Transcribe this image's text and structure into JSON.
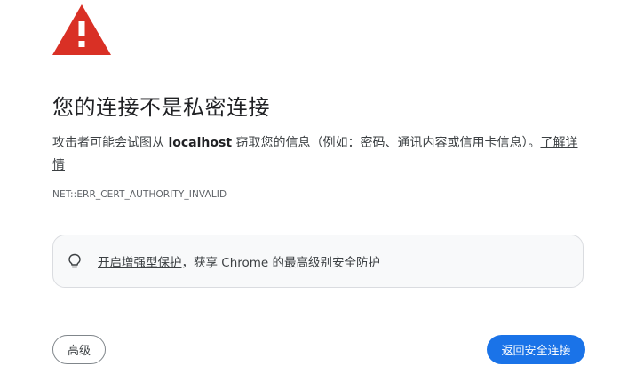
{
  "interstitial": {
    "title": "您的连接不是私密连接",
    "description": {
      "prefix": "攻击者可能会试图从 ",
      "host": "localhost",
      "suffix": " 窃取您的信息（例如：密码、通讯内容或信用卡信息）。",
      "learn_more": "了解详情"
    },
    "error_code": "NET::ERR_CERT_AUTHORITY_INVALID",
    "enhanced_protection": {
      "link_text": "开启增强型保护",
      "rest_text": "，获享 Chrome 的最高级别安全防护",
      "icon": "lightbulb-icon"
    },
    "buttons": {
      "advanced": "高级",
      "back_to_safety": "返回安全连接"
    },
    "warning_icon": "warning-triangle-icon"
  },
  "colors": {
    "warning_red": "#d93025",
    "primary_blue": "#1a73e8",
    "card_border": "#dadce0",
    "text_primary": "#202124",
    "text_secondary": "#5f6368"
  }
}
